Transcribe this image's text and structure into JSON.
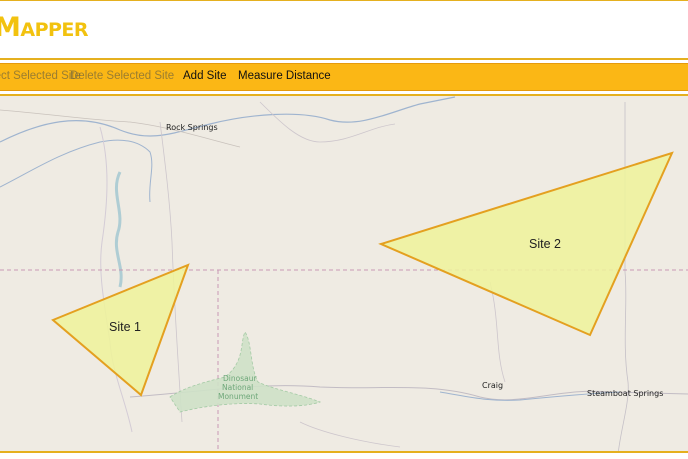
{
  "app": {
    "logo_text": "Mapper"
  },
  "toolbar": {
    "items": [
      {
        "label": "Select Selected Site",
        "enabled": false
      },
      {
        "label": "Delete Selected Site",
        "enabled": false
      },
      {
        "label": "Add Site",
        "enabled": true
      },
      {
        "label": "Measure Distance",
        "enabled": true
      }
    ]
  },
  "map": {
    "places": {
      "rock_springs": "Rock Springs",
      "craig": "Craig",
      "steamboat_springs": "Steamboat Springs"
    },
    "park": {
      "line1": "Dinosaur",
      "line2": "National",
      "line3": "Monument"
    },
    "sites": [
      {
        "label": "Site 1"
      },
      {
        "label": "Site 2"
      }
    ],
    "colors": {
      "site_fill": "#eef39a",
      "site_stroke": "#e4a020",
      "background": "#efebe3",
      "accent": "#fbb715"
    }
  }
}
